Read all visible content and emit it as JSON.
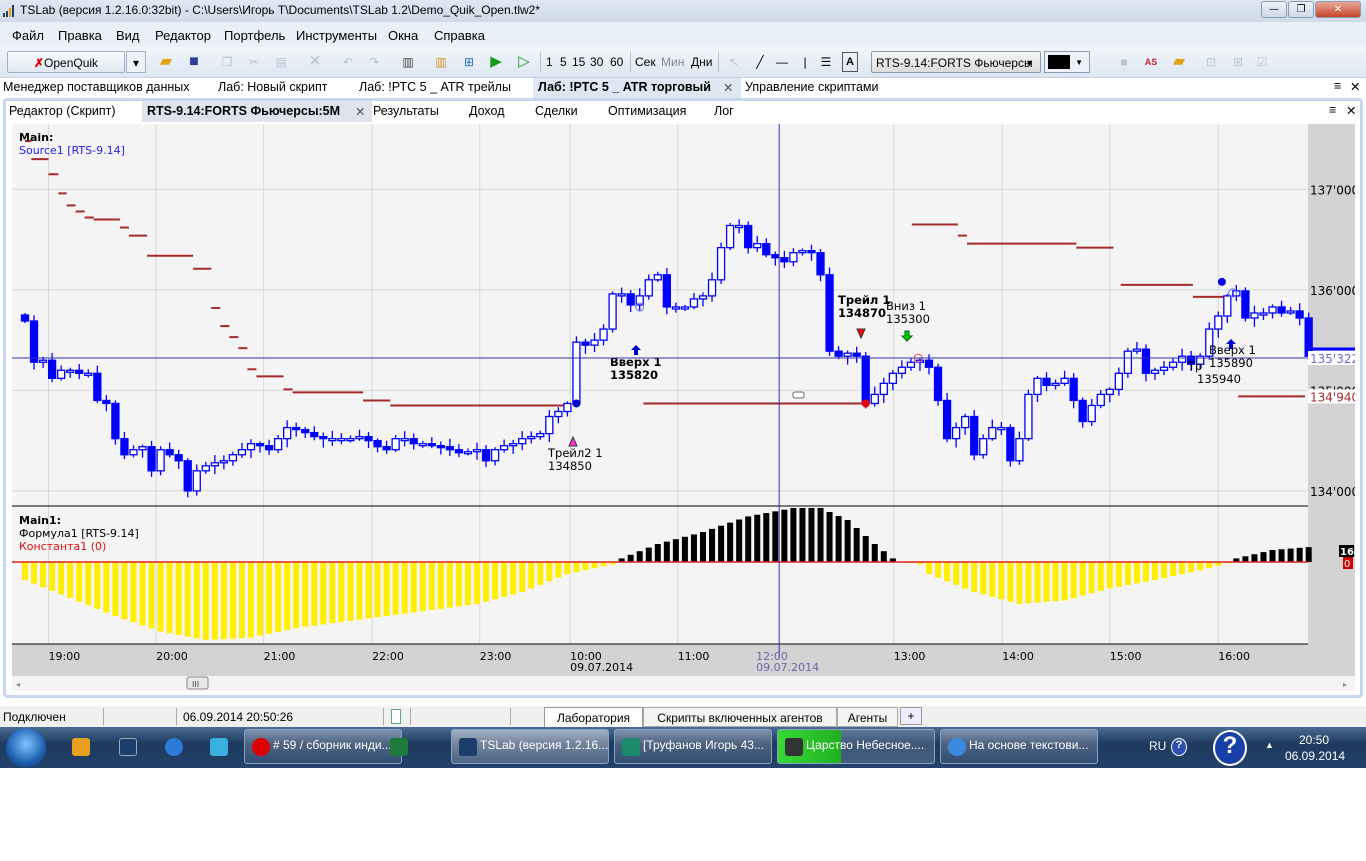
{
  "window": {
    "title": "TSLab (версия 1.2.16.0:32bit) - C:\\Users\\Игорь Т\\Documents\\TSLab 1.2\\Demo_Quik_Open.tlw2*",
    "minimize": "—",
    "maximize": "❐",
    "close": "✕"
  },
  "menu": [
    "Файл",
    "Правка",
    "Вид",
    "Редактор",
    "Портфель",
    "Инструменты",
    "Окна",
    "Справка"
  ],
  "toolbar": {
    "provider": "OpenQuik",
    "intervals": [
      "1",
      "5",
      "15",
      "30",
      "60"
    ],
    "units": [
      "Сек",
      "Мин",
      "Дни"
    ],
    "instrument": "RTS-9.14:FORTS Фьючерсы",
    "color_swatch": "#000000"
  },
  "doc_tabs": [
    {
      "label": "Менеджер поставщиков данных"
    },
    {
      "label": "Лаб: Новый скрипт"
    },
    {
      "label": "Лаб: !РТС 5 _ ATR трейлы"
    },
    {
      "label": "Лаб: !РТС 5 _ ATR торговый",
      "active": true
    },
    {
      "label": "Управление скриптами"
    }
  ],
  "inner_tabs": [
    {
      "label": "Редактор (Скрипт)"
    },
    {
      "label": "RTS-9.14:FORTS Фьючерсы:5M",
      "active": true
    },
    {
      "label": "Результаты"
    },
    {
      "label": "Доход"
    },
    {
      "label": "Сделки"
    },
    {
      "label": "Оптимизация"
    },
    {
      "label": "Лог"
    }
  ],
  "chart_data": {
    "type": "candlestick",
    "main_pane": {
      "title": "Main:",
      "source": "Source1 [RTS-9.14]"
    },
    "indicator_pane": {
      "title": "Main1:",
      "formula": "Формула1 [RTS-9.14]",
      "constant": "Константа1 (0)",
      "last_value": "16",
      "zero_label": "0"
    },
    "y_ticks": [
      "137'000",
      "136'000",
      "135'000",
      "134'000"
    ],
    "y_tick_values": [
      137000,
      136000,
      135000,
      134000
    ],
    "ylim": [
      133850,
      137650
    ],
    "current_price": {
      "label": "135'322",
      "value": 135322,
      "color": "#0000ff"
    },
    "stop_price": {
      "label": "134'940",
      "value": 134940,
      "color": "#a52a2a"
    },
    "x_labels": [
      {
        "t": "19:00",
        "i": 2.6
      },
      {
        "t": "20:00",
        "i": 14.5
      },
      {
        "t": "21:00",
        "i": 26.4
      },
      {
        "t": "22:00",
        "i": 38.4
      },
      {
        "t": "23:00",
        "i": 50.3
      },
      {
        "t": "10:00",
        "d": "09.07.2014",
        "i": 60.3
      },
      {
        "t": "11:00",
        "i": 72.2
      },
      {
        "t": "12:00",
        "d": "09.07.2014",
        "i": 84.2,
        "cursor": true
      },
      {
        "t": "13:00",
        "i": 96.1
      },
      {
        "t": "14:00",
        "i": 108.1
      },
      {
        "t": "15:00",
        "i": 120
      },
      {
        "t": "16:00",
        "i": 132
      }
    ],
    "closes": [
      135690,
      135280,
      135300,
      135120,
      135200,
      135200,
      135170,
      135170,
      134900,
      134870,
      134520,
      134360,
      134410,
      134440,
      134200,
      134410,
      134360,
      134300,
      134000,
      134200,
      134250,
      134280,
      134300,
      134360,
      134410,
      134470,
      134450,
      134410,
      134520,
      134630,
      134610,
      134580,
      134540,
      134520,
      134520,
      134520,
      134520,
      134540,
      134500,
      134440,
      134410,
      134520,
      134520,
      134470,
      134470,
      134450,
      134440,
      134410,
      134380,
      134390,
      134410,
      134300,
      134410,
      134450,
      134470,
      134520,
      134540,
      134570,
      134740,
      134790,
      134870,
      135480,
      135450,
      135500,
      135610,
      135960,
      135960,
      135850,
      135940,
      136100,
      136150,
      135830,
      135830,
      135830,
      135910,
      135940,
      136100,
      136420,
      136640,
      136640,
      136420,
      136460,
      136350,
      136320,
      136280,
      136370,
      136390,
      136370,
      136150,
      135390,
      135340,
      135370,
      135340,
      134870,
      134960,
      135070,
      135170,
      135230,
      135280,
      135300,
      135230,
      134900,
      134520,
      134630,
      134740,
      134360,
      134520,
      134630,
      134630,
      134300,
      134520,
      134960,
      135120,
      135050,
      135070,
      135120,
      134900,
      134690,
      134850,
      134960,
      135010,
      135170,
      135390,
      135410,
      135170,
      135200,
      135230,
      135280,
      135340,
      135260,
      135340,
      135610,
      135740,
      135940,
      135990,
      135720,
      135770,
      135770,
      135830,
      135770,
      135790,
      135720,
      135340
    ],
    "stop_segments": [
      [
        0,
        0.7,
        137480
      ],
      [
        0.7,
        2.6,
        137300
      ],
      [
        2.6,
        3.7,
        137150
      ],
      [
        3.7,
        4.6,
        136960
      ],
      [
        4.6,
        5.6,
        136840
      ],
      [
        5.6,
        6.6,
        136780
      ],
      [
        6.6,
        7.6,
        136720
      ],
      [
        7.6,
        10.5,
        136700
      ],
      [
        10.5,
        11.5,
        136620
      ],
      [
        11.5,
        13.5,
        136540
      ],
      [
        13.5,
        18.6,
        136340
      ],
      [
        18.6,
        20.6,
        136210
      ],
      [
        20.6,
        21.6,
        135820
      ],
      [
        21.6,
        22.6,
        135640
      ],
      [
        22.6,
        23.6,
        135530
      ],
      [
        23.6,
        24.6,
        135420
      ],
      [
        24.6,
        25.6,
        135210
      ],
      [
        25.6,
        28.6,
        135140
      ],
      [
        28.6,
        29.6,
        135010
      ],
      [
        29.6,
        37.4,
        134980
      ],
      [
        37.4,
        40.4,
        134900
      ],
      [
        40.4,
        60.3,
        134850
      ],
      [
        68.4,
        92.6,
        134870
      ],
      [
        98.1,
        103.2,
        136650
      ],
      [
        103.2,
        104.2,
        136540
      ],
      [
        104.2,
        116.3,
        136460
      ],
      [
        116.3,
        120.4,
        136420
      ],
      [
        121.2,
        129.2,
        136050
      ],
      [
        129.2,
        133.3,
        135930
      ],
      [
        134.2,
        141.6,
        134940
      ]
    ],
    "oscillator_keypoints": [
      [
        0,
        -15
      ],
      [
        5,
        -30
      ],
      [
        10,
        -45
      ],
      [
        15,
        -58
      ],
      [
        20,
        -65
      ],
      [
        25,
        -63
      ],
      [
        30,
        -55
      ],
      [
        40,
        -45
      ],
      [
        50,
        -35
      ],
      [
        55,
        -25
      ],
      [
        60,
        -10
      ],
      [
        65,
        -2
      ],
      [
        66,
        3
      ],
      [
        70,
        15
      ],
      [
        75,
        25
      ],
      [
        80,
        38
      ],
      [
        85,
        45
      ],
      [
        88,
        45
      ],
      [
        91,
        35
      ],
      [
        94,
        15
      ],
      [
        96,
        3
      ],
      [
        97,
        0
      ],
      [
        99,
        -2
      ],
      [
        100,
        -10
      ],
      [
        105,
        -25
      ],
      [
        110,
        -35
      ],
      [
        115,
        -32
      ],
      [
        120,
        -22
      ],
      [
        125,
        -15
      ],
      [
        130,
        -7
      ],
      [
        133,
        -1
      ],
      [
        134,
        3
      ],
      [
        138,
        10
      ],
      [
        143,
        13
      ]
    ],
    "osc_range": [
      -70,
      60
    ],
    "annotations": [
      {
        "label": "Вверх 1",
        "value": "135820",
        "bold": true,
        "i": 65.5,
        "marker": "arrow-up",
        "color": "#0000cc"
      },
      {
        "label": "Трейл2 1",
        "value": "134850",
        "bold": false,
        "i": 60.7,
        "marker": "triangle-up",
        "color": "#ff33cc"
      },
      {
        "label": "Трейл 1",
        "value": "134870",
        "bold": true,
        "i": 92.6,
        "marker": "triangle-down",
        "color": "#ff0000"
      },
      {
        "label": "Вниз 1",
        "value": "135300",
        "bold": false,
        "i": 97.6,
        "marker": "arrow-down",
        "color": "#00cc00"
      },
      {
        "label": "Вверх 1",
        "value": "135890",
        "bold": false,
        "i": 133.4,
        "marker": "arrow-up",
        "color": "#0000cc"
      },
      {
        "label": "Тр",
        "value": "135940",
        "bold": false,
        "i": 131,
        "marker": "none",
        "color": "#000"
      }
    ]
  },
  "status": {
    "connection": "Подключен",
    "datetime": "06.09.2014 20:50:26",
    "tabs": [
      "Лаборатория",
      "Скрипты включенных агентов",
      "Агенты",
      "+"
    ]
  },
  "taskbar": {
    "items": [
      "# 59 / сборник инди...",
      "TSLab (версия 1.2.16...",
      "[Труфанов Игорь 43...",
      "Царство Небесное....",
      "На основе текстови..."
    ],
    "lang": "RU",
    "time": "20:50",
    "date": "06.09.2014"
  }
}
